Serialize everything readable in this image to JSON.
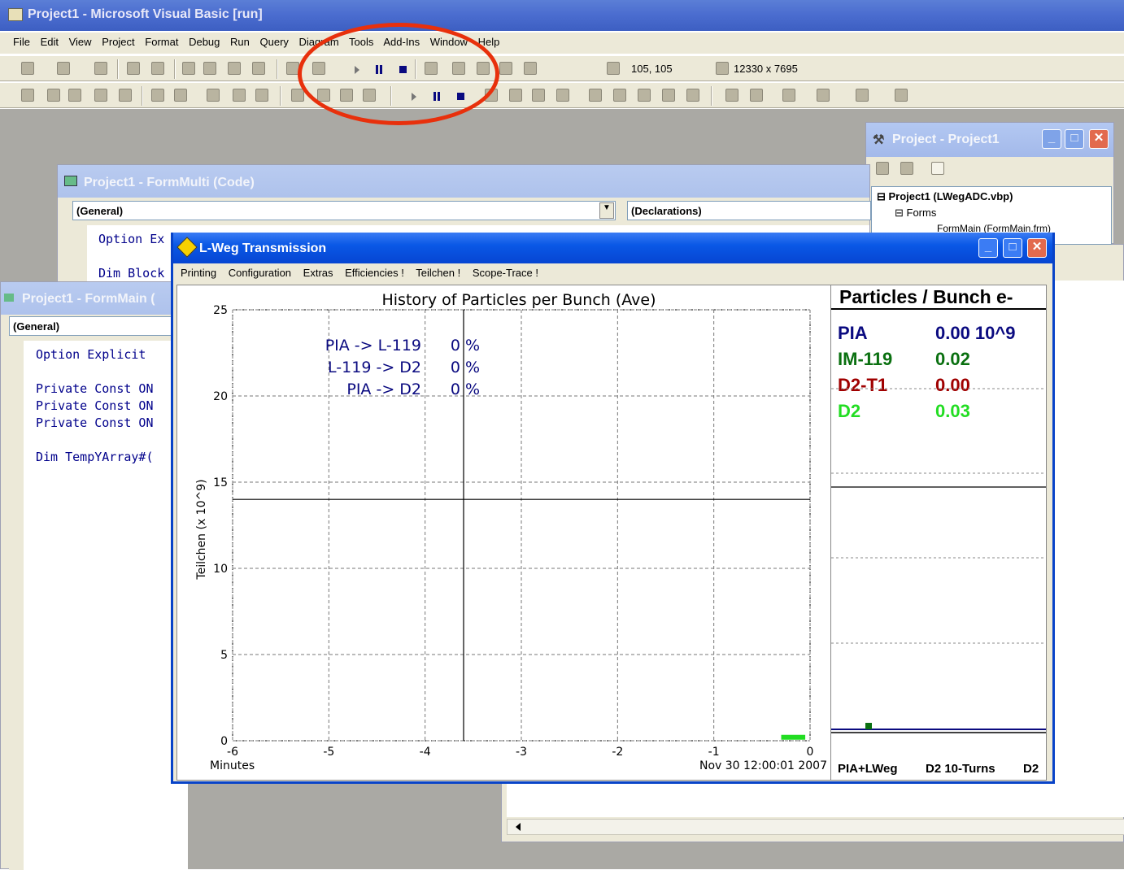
{
  "vb": {
    "title": "Project1 - Microsoft Visual Basic [run]",
    "menu": [
      "File",
      "Edit",
      "View",
      "Project",
      "Format",
      "Debug",
      "Run",
      "Query",
      "Diagram",
      "Tools",
      "Add-Ins",
      "Window",
      "Help"
    ],
    "position": "105, 105",
    "size": "12330 x 7695"
  },
  "project_explorer": {
    "title": "Project - Project1",
    "tree": [
      "Project1 (LWegADC.vbp)",
      "Forms",
      "FormMain (FormMain.frm)"
    ]
  },
  "code_multi": {
    "title": "Project1 - FormMulti (Code)",
    "object_combo": "(General)",
    "proc_combo": "(Declarations)",
    "lines": [
      "Option Ex",
      "Dim Block"
    ]
  },
  "code_main": {
    "title": "Project1 - FormMain (",
    "object_combo": "(General)",
    "lines": [
      "Option Explicit",
      "Private Const ON",
      "Private Const ON",
      "Private Const ON",
      "Dim TempYArray#("
    ]
  },
  "lweg": {
    "title": "L-Weg Transmission",
    "menu": [
      "Printing",
      "Configuration",
      "Extras",
      "Efficiencies !",
      "Teilchen !",
      "Scope-Trace !"
    ],
    "side_title": "Particles / Bunch e-",
    "legend": [
      {
        "name": "PIA",
        "value": "0.00 10^9",
        "color": "#0a0a80"
      },
      {
        "name": "IM-119",
        "value": "0.02",
        "color": "#0a7010"
      },
      {
        "name": "D2-T1",
        "value": "0.00",
        "color": "#a00000"
      },
      {
        "name": "D2",
        "value": "0.03",
        "color": "#22dd22"
      }
    ],
    "side_bottom": [
      "PIA+LWeg",
      "D2 10-Turns",
      "D2"
    ]
  },
  "chart_data": {
    "type": "line",
    "title": "History of Particles per Bunch (Ave)",
    "xlabel": "Minutes",
    "ylabel": "Teilchen   (x 10^9)",
    "x_ticks": [
      "-6",
      "-5",
      "-4",
      "-3",
      "-2",
      "-1",
      "0"
    ],
    "y_ticks": [
      "0",
      "5",
      "10",
      "15",
      "20",
      "25"
    ],
    "xlim": [
      -6,
      0
    ],
    "ylim": [
      0,
      25
    ],
    "date_label": "Nov 30 12:00:01 2007",
    "grid": true,
    "annotations": [
      {
        "label": "PIA -> L-119",
        "value": "0 %"
      },
      {
        "label": "L-119 -> D2",
        "value": "0 %"
      },
      {
        "label": "PIA -> D2",
        "value": "0 %"
      }
    ],
    "series": [
      {
        "name": "D2",
        "x": [
          -0.3,
          -0.05
        ],
        "y": [
          0.2,
          0.2
        ]
      }
    ],
    "cursor": {
      "x": -3.6,
      "y": 14
    }
  }
}
